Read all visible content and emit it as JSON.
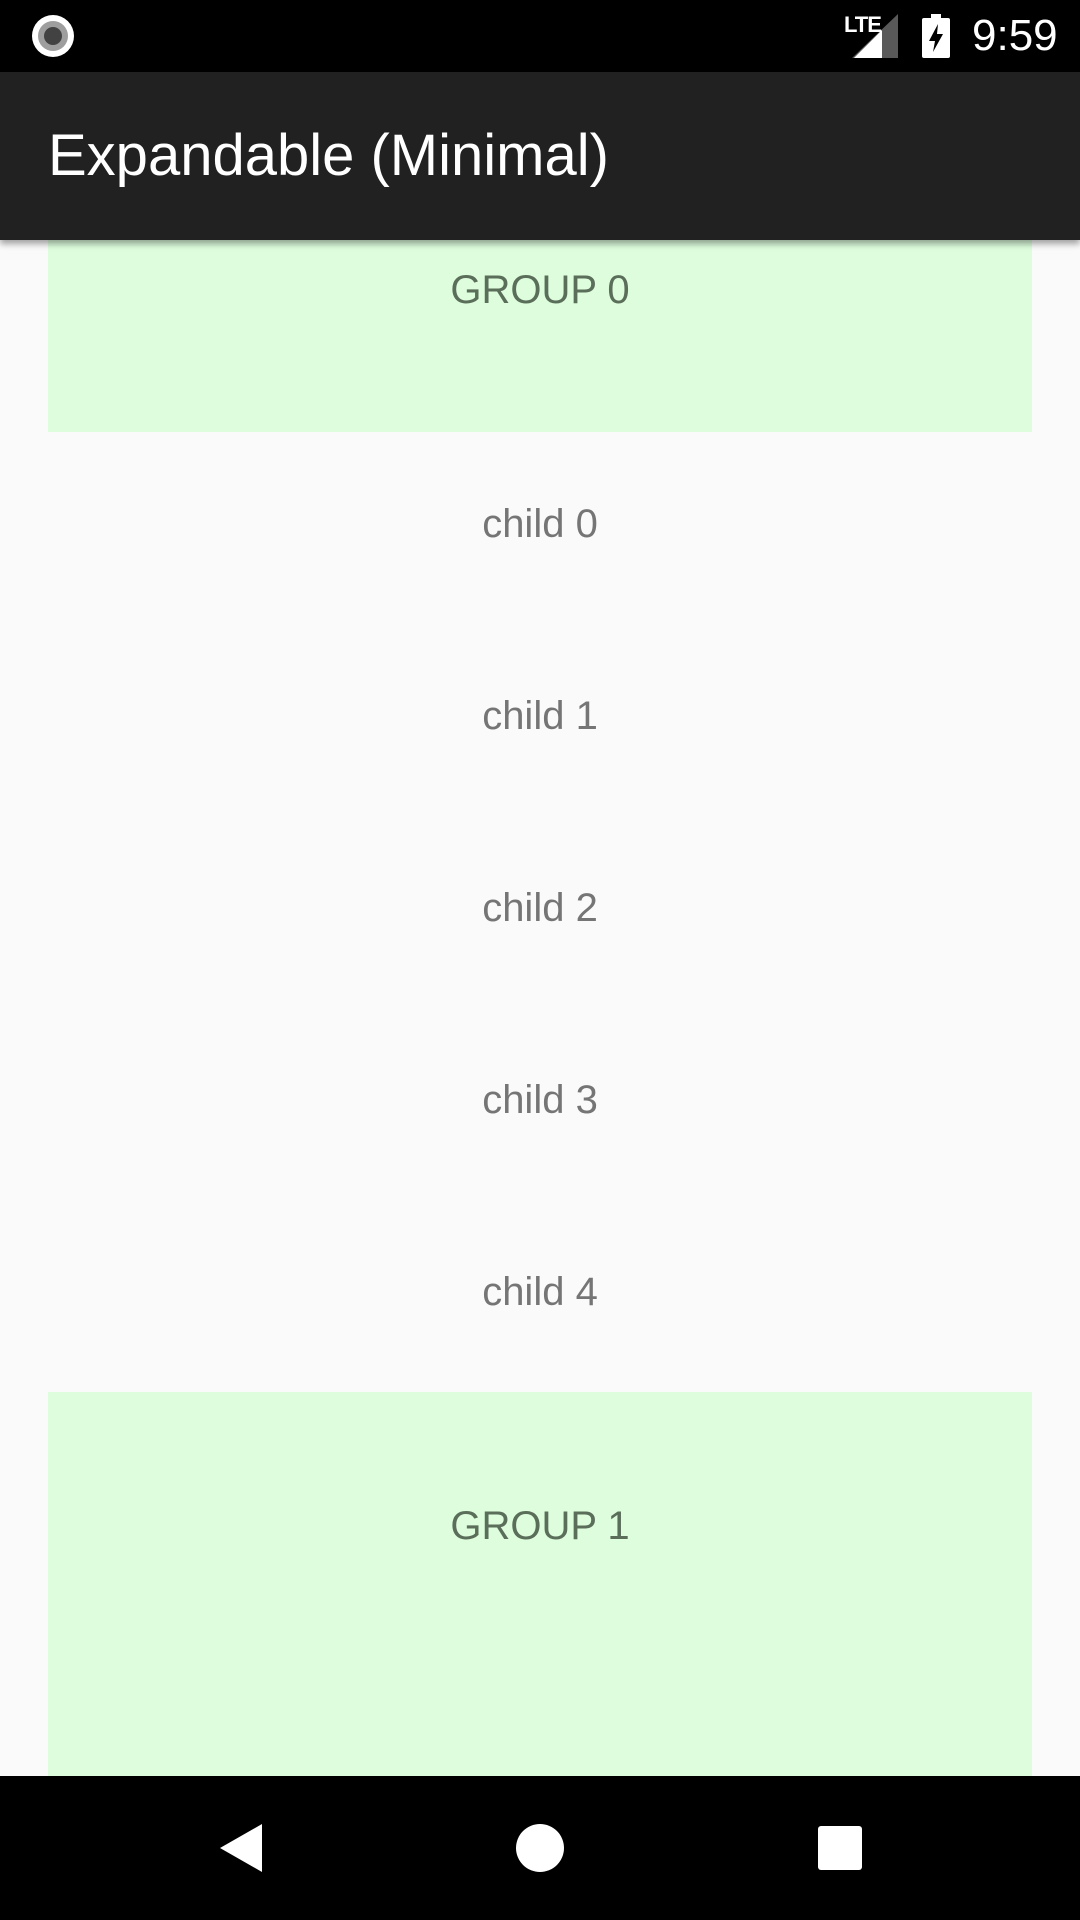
{
  "status_bar": {
    "network_label": "LTE",
    "time": "9:59",
    "icons": [
      "record-icon",
      "signal-icon",
      "battery-charging-icon"
    ]
  },
  "app_bar": {
    "title": "Expandable (Minimal)",
    "background": "#212121"
  },
  "list": {
    "group_background": "#ddfddd",
    "groups": [
      {
        "label": "GROUP 0",
        "children": [
          "child 0",
          "child 1",
          "child 2",
          "child 3",
          "child 4"
        ]
      },
      {
        "label": "GROUP 1",
        "children": []
      }
    ]
  },
  "nav_bar": {
    "icons": [
      "back-icon",
      "home-icon",
      "recents-icon"
    ]
  }
}
